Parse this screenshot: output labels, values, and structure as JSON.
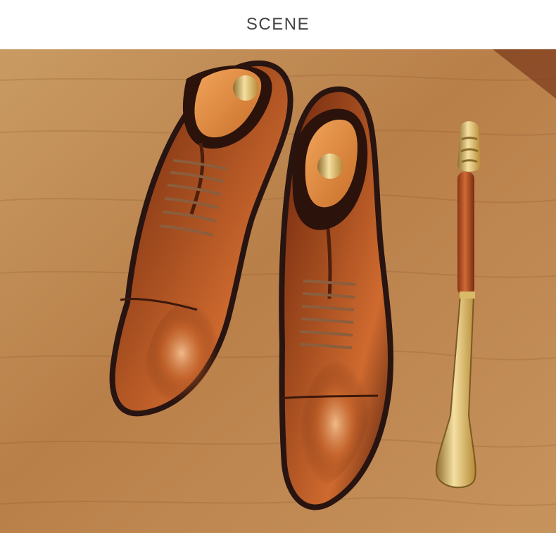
{
  "header": {
    "title": "SCENE"
  },
  "scene": {
    "description_icons": [
      "wood-table-background",
      "left-oxford-shoe",
      "right-oxford-shoe",
      "shoe-horn"
    ],
    "colors": {
      "wood": "#c18c57",
      "wood_dark": "#a96e39",
      "leather": "#9b3f16",
      "leather_highlight": "#d06a2e",
      "sole": "#2b1a14",
      "brass": "#d8b64b",
      "tree_wood": "#e28a3d"
    }
  }
}
